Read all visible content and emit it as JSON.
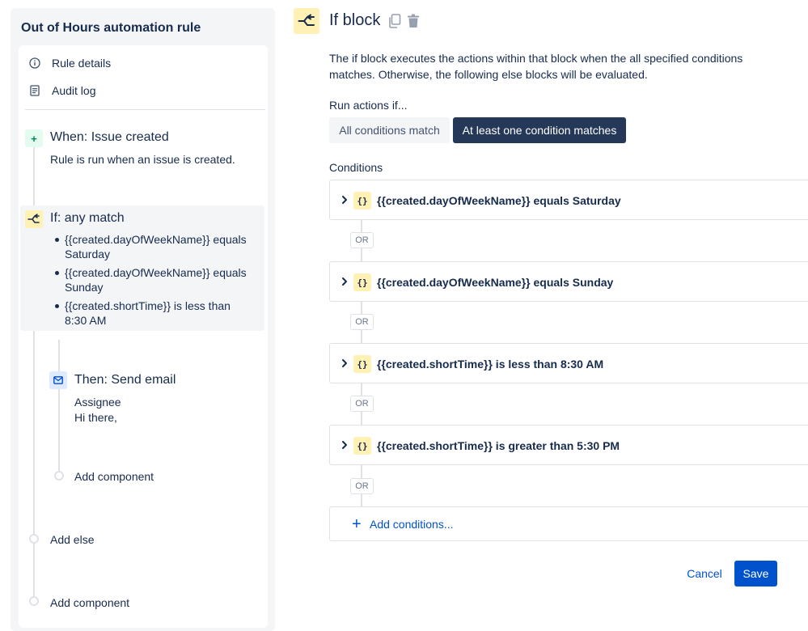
{
  "sidebar": {
    "title": "Out of Hours automation rule",
    "nav": [
      {
        "label": "Rule details",
        "icon": "info-icon"
      },
      {
        "label": "Audit log",
        "icon": "document-icon"
      }
    ],
    "trigger": {
      "icon": "plus-icon",
      "title": "When: Issue created",
      "description": "Rule is run when an issue is created."
    },
    "condition": {
      "icon": "branch-icon",
      "title": "If: any match",
      "items": [
        "{{created.dayOfWeekName}} equals Saturday",
        "{{created.dayOfWeekName}} equals Sunday",
        "{{created.shortTime}} is less than 8:30 AM"
      ]
    },
    "action": {
      "icon": "mail-icon",
      "title": "Then: Send email",
      "line1": "Assignee",
      "line2": "Hi there,"
    },
    "add_component_inner": "Add component",
    "add_else": "Add else",
    "add_component_outer": "Add component"
  },
  "main": {
    "icon": "branch-icon",
    "title": "If block",
    "copy_icon": "copy-icon",
    "delete_icon": "trash-icon",
    "description": "The if block executes the actions within that block when the all specified conditions matches. Otherwise, the following else blocks will be evaluated.",
    "run_label": "Run actions if...",
    "toggle": {
      "all_label": "All conditions match",
      "any_label": "At least one condition matches",
      "selected": "any"
    },
    "conditions_label": "Conditions",
    "conditions": [
      {
        "text": "{{created.dayOfWeekName}} equals Saturday"
      },
      {
        "text": "{{created.dayOfWeekName}} equals Sunday"
      },
      {
        "text": "{{created.shortTime}} is less than 8:30 AM"
      },
      {
        "text": "{{created.shortTime}} is greater than 5:30 PM"
      }
    ],
    "or_label": "OR",
    "condition_icon_glyph": "{}",
    "add_conditions": "Add conditions...",
    "cancel": "Cancel",
    "save": "Save"
  },
  "colors": {
    "accent": "#0052cc",
    "selected_toggle": "#253858",
    "condition_icon_bg": "#fff0b3",
    "trigger_icon_bg": "#e3fcef",
    "action_icon_bg": "#deebff"
  }
}
